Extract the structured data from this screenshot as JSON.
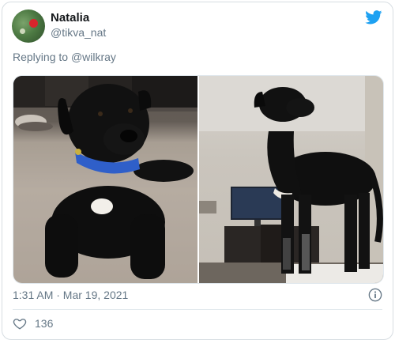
{
  "tweet": {
    "author": {
      "display_name": "Natalia",
      "handle": "@tikva_nat",
      "avatar_icon": "profile-photo"
    },
    "brand_color": "#1da1f2",
    "reply_label": "Replying to",
    "reply_to": "@wilkray",
    "timestamp": "1:31 AM · Mar 19, 2021",
    "likes": "136",
    "media": [
      {
        "icon": "black-puppy-lying-on-carpet-photo"
      },
      {
        "icon": "black-dog-standing-on-desk-photo"
      }
    ]
  }
}
